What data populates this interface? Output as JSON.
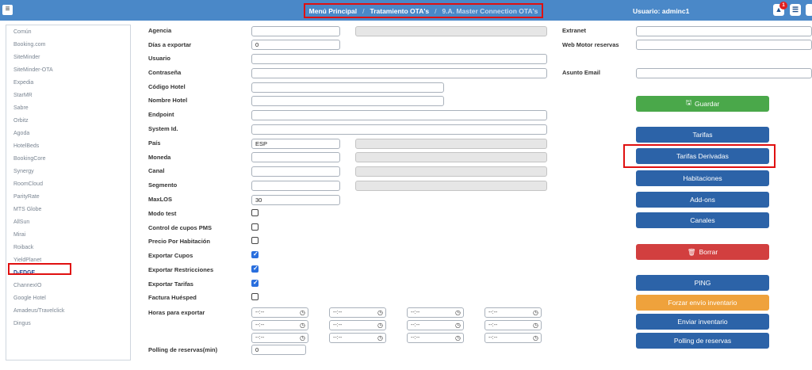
{
  "topbar": {
    "breadcrumb": [
      "Menú Principal",
      "Tratamiento OTA's",
      "9.A. Master Connection OTA's"
    ],
    "user": "Usuario: adminc1",
    "notification_count": "1"
  },
  "sidebar": {
    "items": [
      "Común",
      "Booking.com",
      "SiteMinder",
      "SiteMinder-OTA",
      "Expedia",
      "StarMR",
      "Sabre",
      "Orbitz",
      "Agoda",
      "HotelBeds",
      "BookingCore",
      "Synergy",
      "RoomCloud",
      "ParityRate",
      "MTS Globe",
      "AllSun",
      "Mirai",
      "Roiback",
      "YieldPlanet",
      "D-EDGE",
      "ChannexIO",
      "Google Hotel",
      "Amadeus/Travelclick",
      "Dingus"
    ],
    "active": "D-EDGE"
  },
  "form": {
    "agencia": {
      "label": "Agencia",
      "value": ""
    },
    "dias": {
      "label": "Días a exportar",
      "value": "0"
    },
    "usuario": {
      "label": "Usuario",
      "value": ""
    },
    "contrasena": {
      "label": "Contraseña",
      "value": ""
    },
    "codigo_hotel": {
      "label": "Código Hotel",
      "value": ""
    },
    "nombre_hotel": {
      "label": "Nombre Hotel",
      "value": ""
    },
    "endpoint": {
      "label": "Endpoint",
      "value": ""
    },
    "system_id": {
      "label": "System Id.",
      "value": ""
    },
    "pais": {
      "label": "País",
      "value": "ESP"
    },
    "moneda": {
      "label": "Moneda",
      "value": ""
    },
    "canal": {
      "label": "Canal",
      "value": ""
    },
    "segmento": {
      "label": "Segmento",
      "value": ""
    },
    "maxlos": {
      "label": "MaxLOS",
      "value": "30"
    },
    "modo_test": {
      "label": "Modo test",
      "checked": false
    },
    "control_cupos": {
      "label": "Control de cupos PMS",
      "checked": false
    },
    "precio_habitacion": {
      "label": "Precio Por Habitación",
      "checked": false
    },
    "exportar_cupos": {
      "label": "Exportar Cupos",
      "checked": true
    },
    "exportar_restricciones": {
      "label": "Exportar Restricciones",
      "checked": true
    },
    "exportar_tarifas": {
      "label": "Exportar Tarifas",
      "checked": true
    },
    "factura_huesped": {
      "label": "Factura Huésped",
      "checked": false
    },
    "horas": {
      "label": "Horas para exportar",
      "placeholder": "--:--"
    },
    "polling": {
      "label": "Polling de reservas(min)",
      "value": "0"
    },
    "extranet": {
      "label": "Extranet",
      "value": ""
    },
    "web_motor": {
      "label": "Web Motor reservas",
      "value": ""
    },
    "asunto_email": {
      "label": "Asunto Email",
      "value": ""
    }
  },
  "buttons": {
    "guardar": "Guardar",
    "tarifas": "Tarifas",
    "tarifas_derivadas": "Tarifas Derivadas",
    "habitaciones": "Habitaciones",
    "addons": "Add-ons",
    "canales": "Canales",
    "borrar": "Borrar",
    "ping": "PING",
    "forzar": "Forzar envío inventario",
    "enviar": "Enviar inventario",
    "polling": "Polling de reservas"
  },
  "colors": {
    "topbar": "#4a88c8",
    "primary": "#2c63a8",
    "success": "#4aa84a",
    "danger": "#d23f3f",
    "warning": "#efa23c",
    "highlight": "#e01010"
  }
}
